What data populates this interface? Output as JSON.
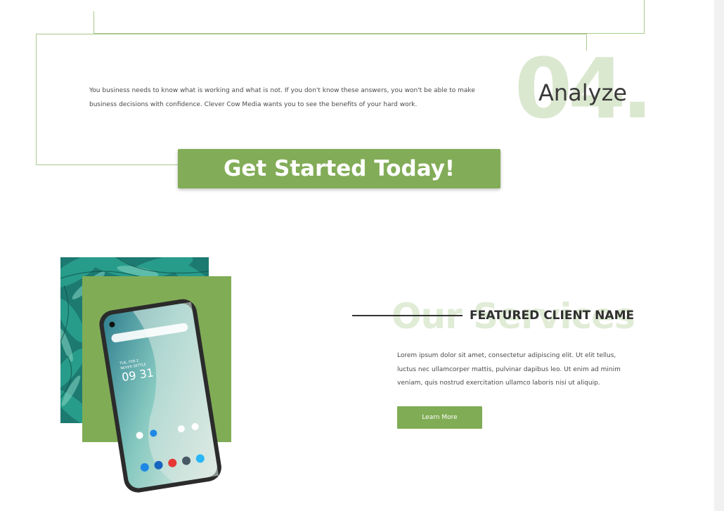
{
  "step": {
    "number": "04.",
    "title": "Analyze",
    "description": "You business needs to know what is working and what is not. If you don't know these answers, you won't be able to make business decisions with confidence. Clever Cow Media wants you to see the benefits of your hard work."
  },
  "cta": {
    "label": "Get Started Today!"
  },
  "services": {
    "watermark": "Our Services",
    "client_name": "FEATURED CLIENT NAME",
    "description": "Lorem ipsum dolor sit amet, consectetur adipiscing elit. Ut elit tellus, luctus nec ullamcorper mattis, pulvinar dapibus leo. Ut enim ad minim veniam, quis nostrud exercitation ullamco laboris nisi ut aliquip.",
    "button_label": "Learn More"
  },
  "phone_screen": {
    "date": "TUE, FEB 2",
    "tagline": "NEVER SETTLE",
    "time": "09 31"
  },
  "colors": {
    "accent": "#82ac57",
    "line": "#a9c98c",
    "watermark": "#dbe8d0",
    "text": "#4a4a4a"
  }
}
